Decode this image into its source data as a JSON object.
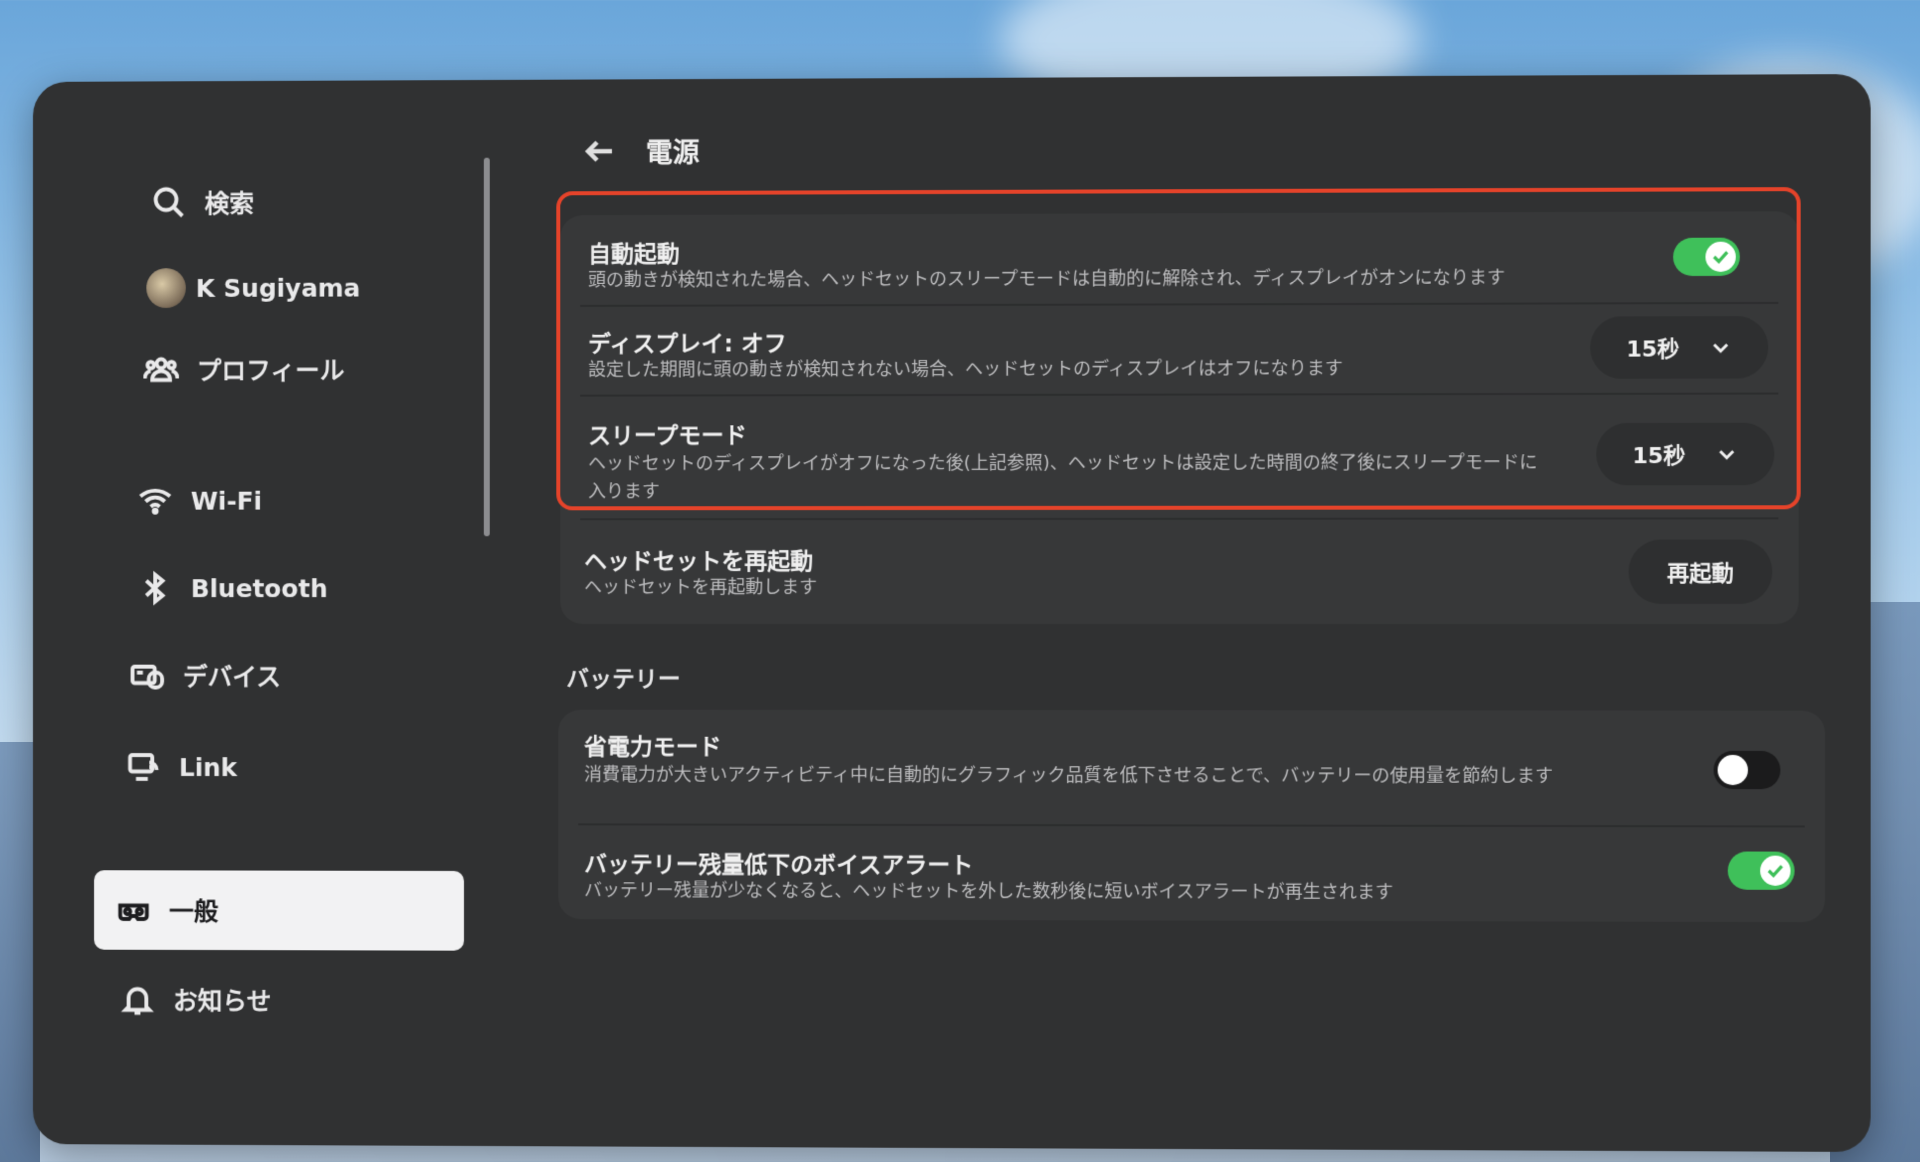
{
  "sidebar": {
    "items": [
      {
        "label": "検索",
        "icon": "search-icon"
      },
      {
        "label": "K Sugiyama",
        "icon": "avatar"
      },
      {
        "label": "プロフィール",
        "icon": "people-icon"
      },
      {
        "label": "Wi-Fi",
        "icon": "wifi-icon"
      },
      {
        "label": "Bluetooth",
        "icon": "bluetooth-icon"
      },
      {
        "label": "デバイス",
        "icon": "devices-icon"
      },
      {
        "label": "Link",
        "icon": "link-icon"
      },
      {
        "label": "一般",
        "icon": "headset-icon",
        "active": true
      },
      {
        "label": "お知らせ",
        "icon": "bell-icon"
      }
    ]
  },
  "header": {
    "title": "電源"
  },
  "power": {
    "auto_wake": {
      "title": "自動起動",
      "desc": "頭の動きが検知された場合、ヘッドセットのスリープモードは自動的に解除され、ディスプレイがオンになります",
      "enabled": true
    },
    "display_off": {
      "title": "ディスプレイ: オフ",
      "desc": "設定した期間に頭の動きが検知されない場合、ヘッドセットのディスプレイはオフになります",
      "value": "15秒"
    },
    "sleep_mode": {
      "title": "スリープモード",
      "desc": "ヘッドセットのディスプレイがオフになった後(上記参照)、ヘッドセットは設定した時間の終了後にスリープモードに入ります",
      "value": "15秒"
    },
    "restart": {
      "title": "ヘッドセットを再起動",
      "desc": "ヘッドセットを再起動します",
      "button": "再起動"
    }
  },
  "battery": {
    "section_label": "バッテリー",
    "power_saving": {
      "title": "省電力モード",
      "desc": "消費電力が大きいアクティビティ中に自動的にグラフィック品質を低下させることで、バッテリーの使用量を節約します",
      "enabled": false
    },
    "low_battery_alert": {
      "title": "バッテリー残量低下のボイスアラート",
      "desc": "バッテリー残量が少なくなると、ヘッドセットを外した数秒後に短いボイスアラートが再生されます",
      "enabled": true
    }
  },
  "colors": {
    "panel": "#303132",
    "card": "#373839",
    "toggle_on": "#3fc05a",
    "highlight": "#e5432a"
  }
}
